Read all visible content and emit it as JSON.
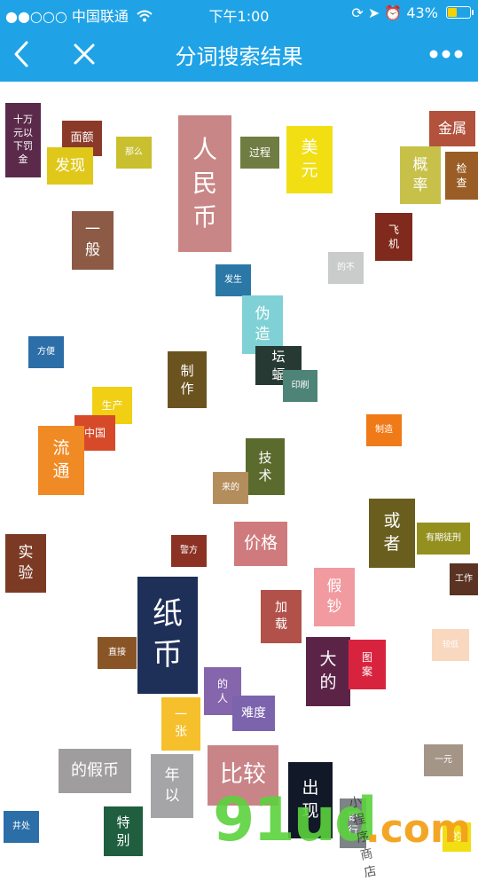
{
  "status": {
    "carrier": "●●○○○ 中国联通",
    "wifi_icon": "wifi-icon",
    "time": "下午1:00",
    "battery_percent": "43%",
    "battery_level": 0.43
  },
  "nav": {
    "title": "分词搜索结果",
    "back_icon": "chevron-left-icon",
    "close_icon": "close-icon",
    "more_icon": "more-dots-icon"
  },
  "tags": [
    {
      "text": "十万\n元以\n下罚\n金",
      "color": "#5b2a4a"
    },
    {
      "text": "面额",
      "color": "#8b3a2a"
    },
    {
      "text": "发现",
      "color": "#e0c81a"
    },
    {
      "text": "那么",
      "color": "#c9bf2f"
    },
    {
      "text": "人\n民\n币",
      "color": "#c98686"
    },
    {
      "text": "过程",
      "color": "#6f7d43"
    },
    {
      "text": "美\n元",
      "color": "#f1df13"
    },
    {
      "text": "金属",
      "color": "#b2523d"
    },
    {
      "text": "概\n率",
      "color": "#c7c14a"
    },
    {
      "text": "检\n查",
      "color": "#9a5d25"
    },
    {
      "text": "一\n般",
      "color": "#8c5a45"
    },
    {
      "text": "飞\n机",
      "color": "#7f2a1c"
    },
    {
      "text": "的不",
      "color": "#c9cccb"
    },
    {
      "text": "发生",
      "color": "#2b78a6"
    },
    {
      "text": "伪\n造",
      "color": "#7fd1d6"
    },
    {
      "text": "方便",
      "color": "#2c6ea8"
    },
    {
      "text": "制\n作",
      "color": "#6b5320"
    },
    {
      "text": "坛\n蝠",
      "color": "#263a33"
    },
    {
      "text": "印刷",
      "color": "#4e8378"
    },
    {
      "text": "生产",
      "color": "#f1cf14"
    },
    {
      "text": "中国",
      "color": "#d64a2a"
    },
    {
      "text": "流\n通",
      "color": "#f08a24"
    },
    {
      "text": "制造",
      "color": "#f07a17"
    },
    {
      "text": "技\n术",
      "color": "#5b6b2e"
    },
    {
      "text": "来的",
      "color": "#b48d5c"
    },
    {
      "text": "或\n者",
      "color": "#6a5e1f"
    },
    {
      "text": "有期徒刑",
      "color": "#93901f"
    },
    {
      "text": "实\n验",
      "color": "#7c3a25"
    },
    {
      "text": "警方",
      "color": "#8c3224"
    },
    {
      "text": "价格",
      "color": "#cf7b7d"
    },
    {
      "text": "假\n钞",
      "color": "#f19aa0"
    },
    {
      "text": "工作",
      "color": "#5b3322"
    },
    {
      "text": "纸\n币",
      "color": "#1e2f58"
    },
    {
      "text": "加\n载",
      "color": "#b2514a"
    },
    {
      "text": "直接",
      "color": "#8a5526"
    },
    {
      "text": "大\n的",
      "color": "#5b2447"
    },
    {
      "text": "图\n案",
      "color": "#d8233f"
    },
    {
      "text": "较低",
      "color": "#f8d8bf"
    },
    {
      "text": "的\n人",
      "color": "#8566ad"
    },
    {
      "text": "难度",
      "color": "#7b63ad"
    },
    {
      "text": "一\n张",
      "color": "#f5c02b"
    },
    {
      "text": "的假币",
      "color": "#a09d9f"
    },
    {
      "text": "年\n以",
      "color": "#a5a4a6"
    },
    {
      "text": "比较",
      "color": "#c98488"
    },
    {
      "text": "出\n现",
      "color": "#111827"
    },
    {
      "text": "一元",
      "color": "#a59587"
    },
    {
      "text": "井处",
      "color": "#2c6ea8"
    },
    {
      "text": "特\n别",
      "color": "#1f5f3f"
    },
    {
      "text": "银\n行",
      "color": "#7d8386"
    },
    {
      "text": "的",
      "color": "#f1df13"
    }
  ],
  "watermark": {
    "big": "91ud",
    "com": ".com",
    "script": "小程序商店"
  }
}
